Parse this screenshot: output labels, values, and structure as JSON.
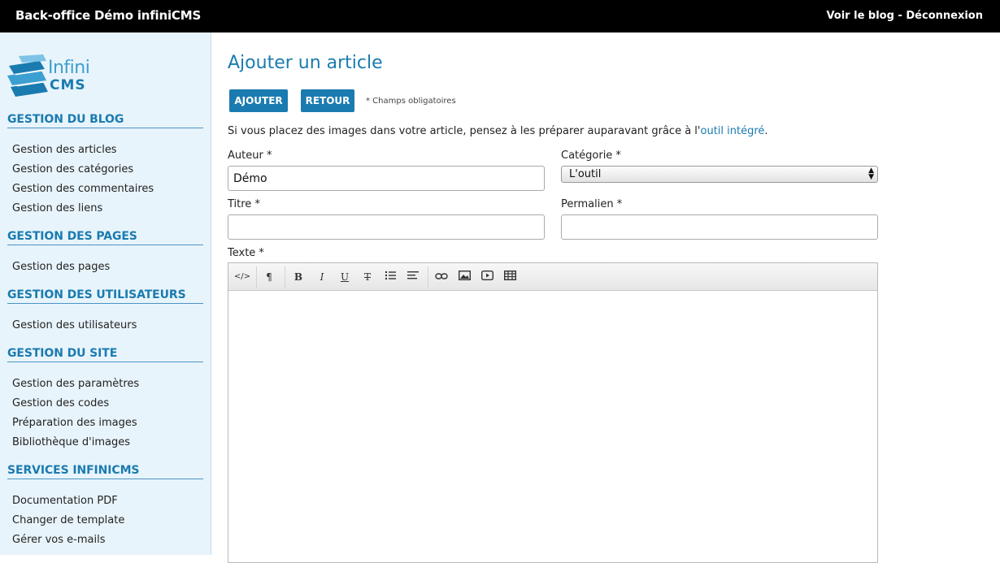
{
  "topbar": {
    "title": "Back-office Démo infiniCMS",
    "link_blog": "Voir le blog",
    "separator": "-",
    "link_logout": "Déconnexion"
  },
  "logo": {
    "line1": "Infini",
    "line2": "CMS"
  },
  "sidebar": {
    "sections": [
      {
        "title": "GESTION DU BLOG",
        "items": [
          "Gestion des articles",
          "Gestion des catégories",
          "Gestion des commentaires",
          "Gestion des liens"
        ]
      },
      {
        "title": "GESTION DES PAGES",
        "items": [
          "Gestion des pages"
        ]
      },
      {
        "title": "GESTION DES UTILISATEURS",
        "items": [
          "Gestion des utilisateurs"
        ]
      },
      {
        "title": "GESTION DU SITE",
        "items": [
          "Gestion des paramètres",
          "Gestion des codes",
          "Préparation des images",
          "Bibliothèque d'images"
        ]
      },
      {
        "title": "SERVICES INFINICMS",
        "items": [
          "Documentation PDF",
          "Changer de template",
          "Gérer vos e-mails"
        ]
      }
    ]
  },
  "main": {
    "title": "Ajouter un article",
    "btn_add": "AJOUTER",
    "btn_back": "RETOUR",
    "required_note": "* Champs obligatoires",
    "intro_before": "Si vous placez des images dans votre article, pensez à les préparer auparavant grâce à l'",
    "intro_link": "outil intégré",
    "intro_after": ".",
    "author_label": "Auteur *",
    "author_value": "Démo",
    "category_label": "Catégorie *",
    "category_value": "L'outil",
    "title_label": "Titre *",
    "title_value": "",
    "permalink_label": "Permalien *",
    "permalink_value": "",
    "text_label": "Texte *"
  },
  "editor": {
    "toolbar": [
      "html-code-icon",
      "paragraph-format-icon",
      "bold-icon",
      "italic-icon",
      "underline-icon",
      "strikethrough-icon",
      "bullet-list-icon",
      "align-icon",
      "link-icon",
      "image-icon",
      "video-icon",
      "table-icon"
    ]
  },
  "colors": {
    "accent": "#1a7bb0",
    "sidebar_bg": "#e8f4fb",
    "topbar_bg": "#000000"
  }
}
